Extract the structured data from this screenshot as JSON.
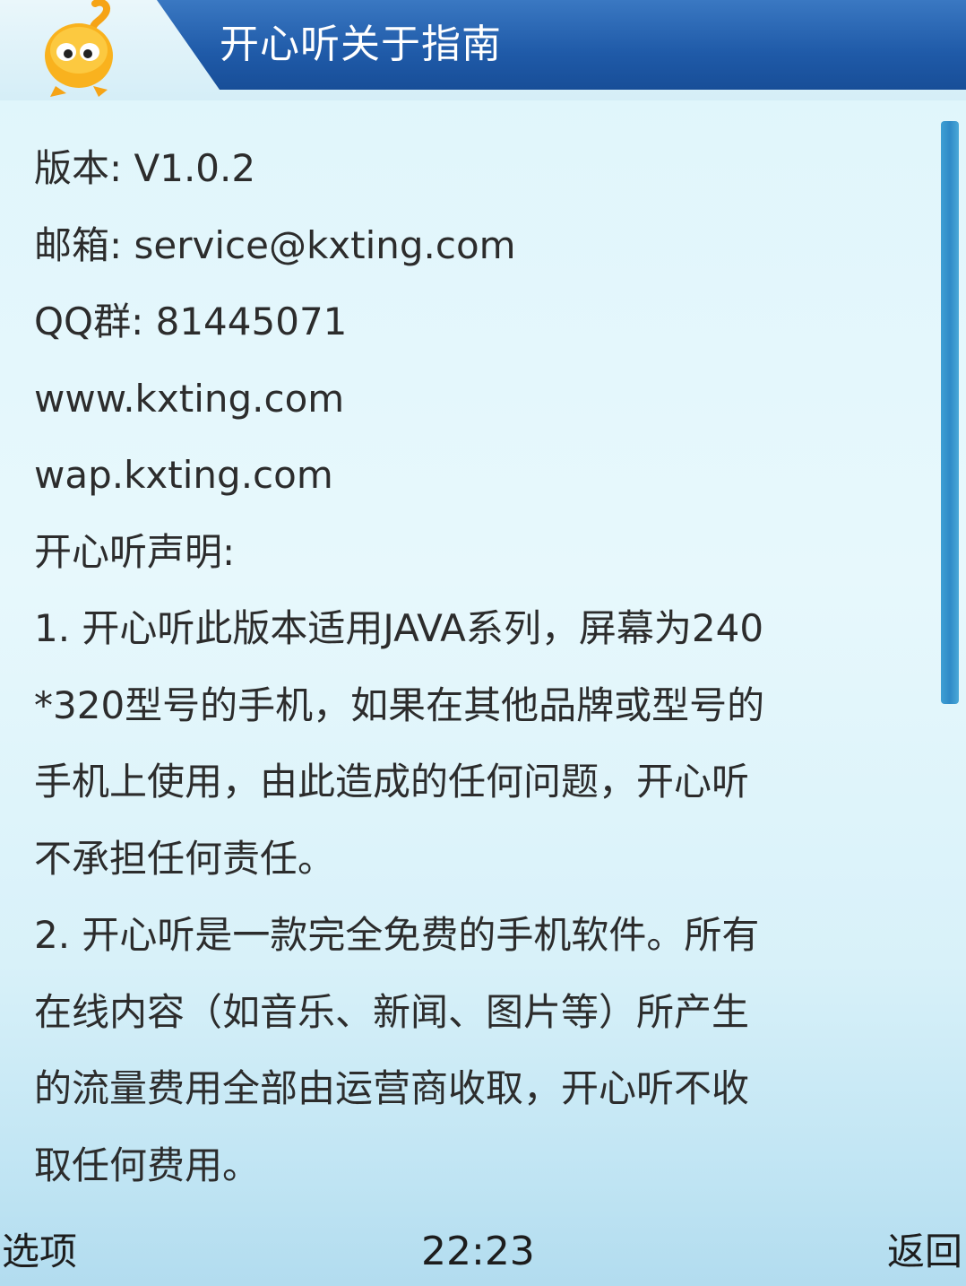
{
  "header": {
    "title": "开心听关于指南",
    "icon": "mascot-logo-icon"
  },
  "content": {
    "lines": [
      "版本: V1.0.2",
      "邮箱: service@kxting.com",
      "QQ群: 81445071",
      "www.kxting.com",
      "wap.kxting.com",
      "开心听声明:",
      "1. 开心听此版本适用JAVA系列，屏幕为240",
      "*320型号的手机，如果在其他品牌或型号的",
      "手机上使用，由此造成的任何问题，开心听",
      "不承担任何责任。",
      "2. 开心听是一款完全免费的手机软件。所有",
      "在线内容（如音乐、新闻、图片等）所产生",
      "的流量费用全部由运营商收取，开心听不收",
      "取任何费用。"
    ]
  },
  "softkeys": {
    "left": "选项",
    "center_time": "22:23",
    "right": "返回"
  },
  "colors": {
    "header_band": "#1f5aa8",
    "background": "#e2f6fb",
    "scroll_thumb": "#2f8ac7",
    "text": "#2c2c2c"
  }
}
